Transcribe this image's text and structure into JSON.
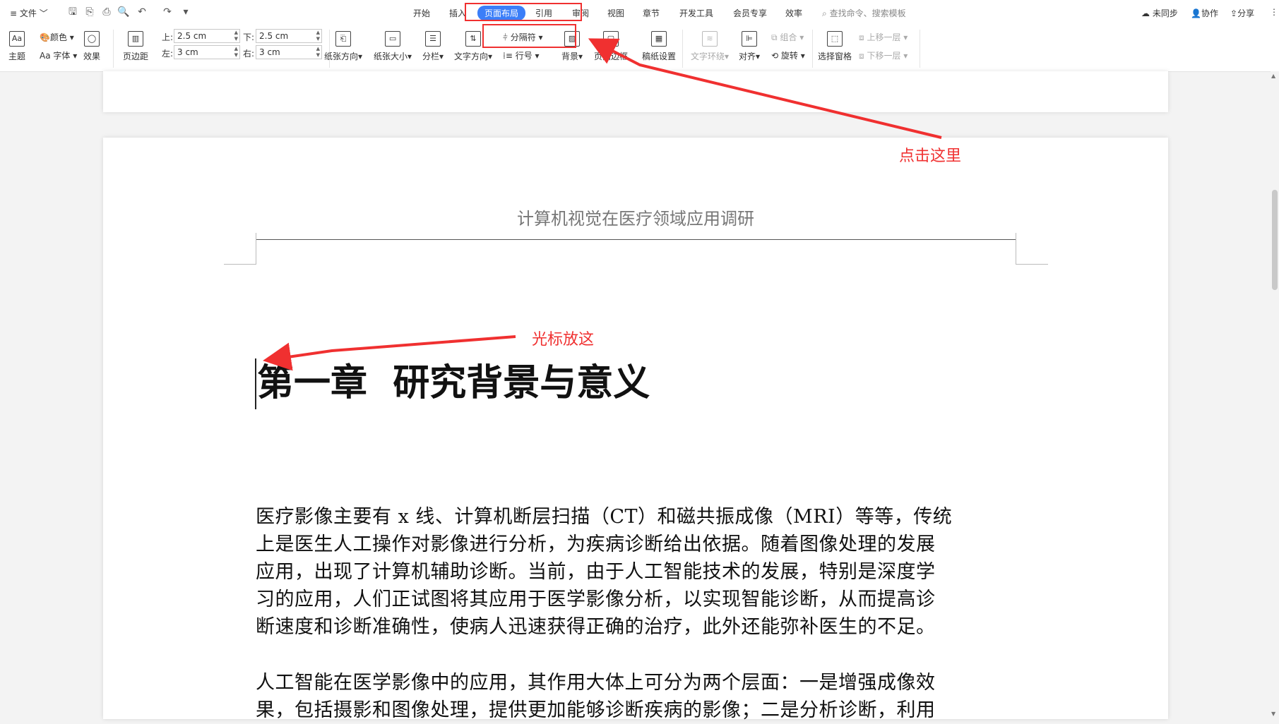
{
  "menubar": {
    "file_label": "文件",
    "tabs": [
      {
        "label": "开始"
      },
      {
        "label": "插入"
      },
      {
        "label": "页面布局"
      },
      {
        "label": "引用"
      },
      {
        "label": "审阅"
      },
      {
        "label": "视图"
      },
      {
        "label": "章节"
      },
      {
        "label": "开发工具"
      },
      {
        "label": "会员专享"
      },
      {
        "label": "效率"
      }
    ],
    "search_placeholder": "查找命令、搜索模板",
    "sync_label": "未同步",
    "collab_label": "协作",
    "share_label": "分享"
  },
  "ribbon": {
    "theme_label": "主题",
    "color_label": "颜色",
    "font_label": "Aa 字体",
    "effect_label": "效果",
    "margin_label": "页边距",
    "top_label": "上:",
    "top_value": "2.5 cm",
    "bottom_label": "下:",
    "bottom_value": "2.5 cm",
    "left_label": "左:",
    "left_value": "3 cm",
    "right_label": "右:",
    "right_value": "3 cm",
    "orientation_label": "纸张方向",
    "size_label": "纸张大小",
    "columns_label": "分栏",
    "text_direction_label": "文字方向",
    "separator_label": "分隔符",
    "line_number_label": "行号",
    "background_label": "背景",
    "page_border_label": "页面边框",
    "page_setup_label": "稿纸设置",
    "text_wrap_label": "文字环绕",
    "align_label": "对齐",
    "group_label": "组合",
    "rotate_label": "旋转",
    "selection_pane_label": "选择窗格",
    "bring_forward_label": "上移一层",
    "send_backward_label": "下移一层"
  },
  "document": {
    "header_text": "计算机视觉在医疗领域应用调研",
    "chapter_title": "第一章  研究背景与意义",
    "paragraph1_lines": [
      "医疗影像主要有 x 线、计算机断层扫描（CT）和磁共振成像（MRI）等等，传统",
      "上是医生人工操作对影像进行分析，为疾病诊断给出依据。随着图像处理的发展",
      "应用，出现了计算机辅助诊断。当前，由于人工智能技术的发展，特别是深度学",
      "习的应用，人们正试图将其应用于医学影像分析，以实现智能诊断，从而提高诊",
      "断速度和诊断准确性，使病人迅速获得正确的治疗，此外还能弥补医生的不足。"
    ],
    "paragraph2_lines": [
      "人工智能在医学影像中的应用，其作用大体上可分为两个层面：一是增强成像效",
      "果，包括摄影和图像处理，提供更加能够诊断疾病的影像；二是分析诊断，利用"
    ]
  },
  "annotations": {
    "click_here": "点击这里",
    "cursor_here": "光标放这"
  },
  "colors": {
    "accent": "#3b7ef8",
    "annotation_red": "#f03030"
  }
}
